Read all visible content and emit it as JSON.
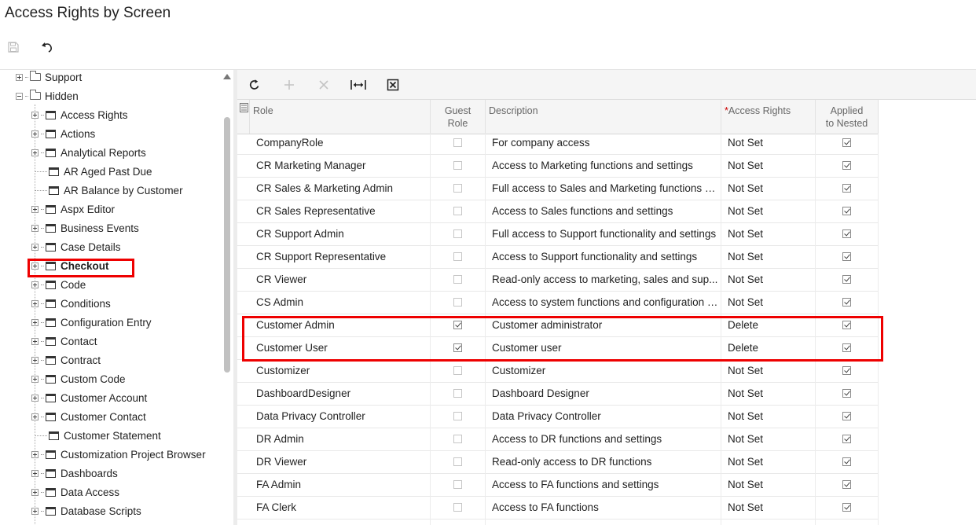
{
  "page": {
    "title": "Access Rights by Screen"
  },
  "toolbar": {
    "save_icon": "save-icon",
    "undo_icon": "undo-icon"
  },
  "tree": {
    "top_nodes": [
      {
        "label": "Support",
        "expander": "plus"
      },
      {
        "label": "Hidden",
        "expander": "minus"
      }
    ],
    "children": [
      {
        "label": "Access Rights",
        "expander": true
      },
      {
        "label": "Actions",
        "expander": true
      },
      {
        "label": "Analytical Reports",
        "expander": true
      },
      {
        "label": "AR Aged Past Due",
        "expander": false
      },
      {
        "label": "AR Balance by Customer",
        "expander": false
      },
      {
        "label": "Aspx Editor",
        "expander": true
      },
      {
        "label": "Business Events",
        "expander": true
      },
      {
        "label": "Case Details",
        "expander": true
      },
      {
        "label": "Checkout",
        "expander": true,
        "selected": true
      },
      {
        "label": "Code",
        "expander": true
      },
      {
        "label": "Conditions",
        "expander": true
      },
      {
        "label": "Configuration Entry",
        "expander": true
      },
      {
        "label": "Contact",
        "expander": true
      },
      {
        "label": "Contract",
        "expander": true
      },
      {
        "label": "Custom Code",
        "expander": true
      },
      {
        "label": "Customer Account",
        "expander": true
      },
      {
        "label": "Customer Contact",
        "expander": true
      },
      {
        "label": "Customer Statement",
        "expander": false
      },
      {
        "label": "Customization Project Browser",
        "expander": true
      },
      {
        "label": "Dashboards",
        "expander": true
      },
      {
        "label": "Data Access",
        "expander": true
      },
      {
        "label": "Database Scripts",
        "expander": true
      }
    ]
  },
  "grid_toolbar": [
    "refresh-icon",
    "add-icon",
    "delete-icon",
    "fit-width-icon",
    "export-excel-icon"
  ],
  "grid": {
    "columns": {
      "role": "Role",
      "guest_line1": "Guest",
      "guest_line2": "Role",
      "description": "Description",
      "access_marker": "*",
      "access": "Access Rights",
      "nested_line1": "Applied",
      "nested_line2": "to Nested"
    },
    "rows": [
      {
        "role": "CompanyRole",
        "guest": false,
        "description": "For company access",
        "access": "Not Set",
        "nested": true
      },
      {
        "role": "CR Marketing Manager",
        "guest": false,
        "description": "Access to Marketing functions and settings",
        "access": "Not Set",
        "nested": true
      },
      {
        "role": "CR Sales & Marketing Admin",
        "guest": false,
        "description": "Full access to Sales and Marketing functions a...",
        "access": "Not Set",
        "nested": true
      },
      {
        "role": "CR Sales Representative",
        "guest": false,
        "description": "Access to Sales functions and settings",
        "access": "Not Set",
        "nested": true
      },
      {
        "role": "CR Support Admin",
        "guest": false,
        "description": "Full access to Support functionality and settings",
        "access": "Not Set",
        "nested": true
      },
      {
        "role": "CR Support Representative",
        "guest": false,
        "description": "Access to Support functionality and settings",
        "access": "Not Set",
        "nested": true
      },
      {
        "role": "CR Viewer",
        "guest": false,
        "description": "Read-only access to marketing, sales and sup...",
        "access": "Not Set",
        "nested": true
      },
      {
        "role": "CS Admin",
        "guest": false,
        "description": "Access to system functions and configuration i...",
        "access": "Not Set",
        "nested": true
      },
      {
        "role": "Customer Admin",
        "guest": true,
        "description": "Customer administrator",
        "access": "Delete",
        "nested": true
      },
      {
        "role": "Customer User",
        "guest": true,
        "description": "Customer user",
        "access": "Delete",
        "nested": true
      },
      {
        "role": "Customizer",
        "guest": false,
        "description": "Customizer",
        "access": "Not Set",
        "nested": true
      },
      {
        "role": "DashboardDesigner",
        "guest": false,
        "description": "Dashboard Designer",
        "access": "Not Set",
        "nested": true
      },
      {
        "role": "Data Privacy Controller",
        "guest": false,
        "description": "Data Privacy Controller",
        "access": "Not Set",
        "nested": true
      },
      {
        "role": "DR Admin",
        "guest": false,
        "description": "Access to DR functions and settings",
        "access": "Not Set",
        "nested": true
      },
      {
        "role": "DR Viewer",
        "guest": false,
        "description": "Read-only access to DR functions",
        "access": "Not Set",
        "nested": true
      },
      {
        "role": "FA Admin",
        "guest": false,
        "description": "Access to FA functions and settings",
        "access": "Not Set",
        "nested": true
      },
      {
        "role": "FA Clerk",
        "guest": false,
        "description": "Access to FA functions",
        "access": "Not Set",
        "nested": true
      }
    ]
  },
  "colors": {
    "highlight": "#e00000"
  }
}
